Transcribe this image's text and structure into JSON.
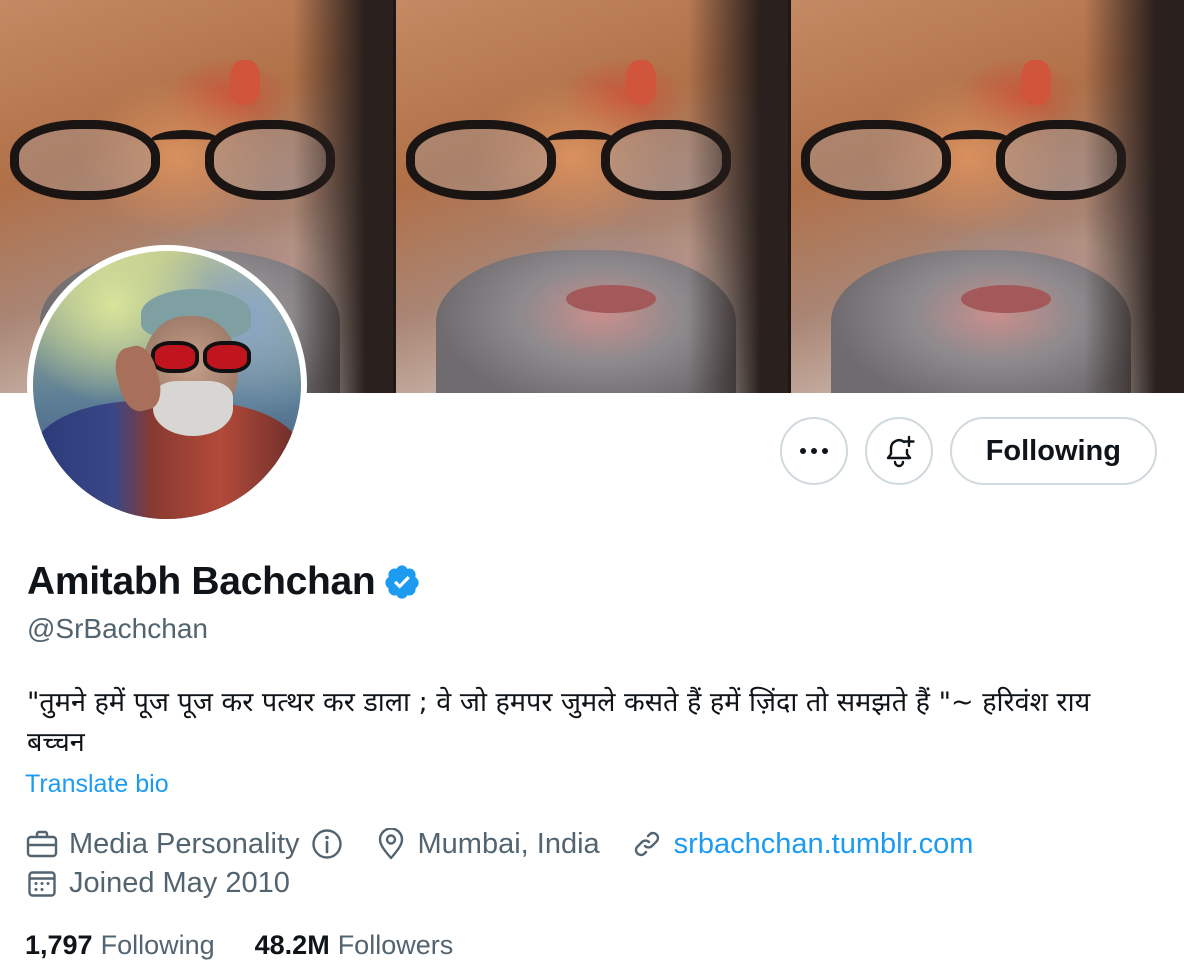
{
  "banner": {
    "panels": [
      "painting-1",
      "painting-2",
      "painting-3"
    ]
  },
  "actions": {
    "more_icon": "more-horizontal-icon",
    "notify_icon": "bell-plus-icon",
    "following_label": "Following"
  },
  "profile": {
    "name": "Amitabh Bachchan",
    "verified_icon": "verified-badge-icon",
    "handle": "@SrBachchan",
    "bio": "\"तुमने हमें पूज पूज कर पत्थर कर डाला ; वे जो हमपर जुमले कसते हैं हमें ज़िंदा तो समझते हैं \"~  हरिवंश राय  बच्चन",
    "translate_label": "Translate bio",
    "category": "Media Personality",
    "location": "Mumbai, India",
    "website": "srbachchan.tumblr.com",
    "joined": "Joined May 2010"
  },
  "stats": {
    "following_count": "1,797",
    "following_label": "Following",
    "followers_count": "48.2M",
    "followers_label": "Followers"
  },
  "colors": {
    "accent": "#1d9bf0",
    "text": "#0f1419",
    "secondary": "#536471",
    "border": "#cfd9de"
  }
}
